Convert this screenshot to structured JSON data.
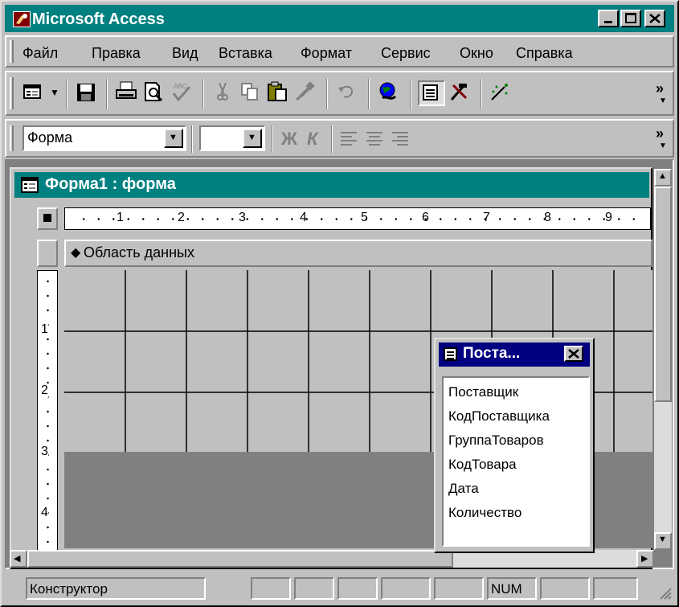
{
  "window": {
    "title": "Microsoft Access"
  },
  "menu": {
    "items": [
      {
        "label": "Файл"
      },
      {
        "label": "Правка"
      },
      {
        "label": "Вид"
      },
      {
        "label": "Вставка"
      },
      {
        "label": "Формат"
      },
      {
        "label": "Сервис"
      },
      {
        "label": "Окно"
      },
      {
        "label": "Справка"
      }
    ]
  },
  "toolbar": {
    "overflow": "»"
  },
  "format_toolbar": {
    "object_value": "Форма",
    "font_value": "",
    "bold": "Ж",
    "italic": "К",
    "overflow": "»"
  },
  "form_window": {
    "title": "Форма1 : форма",
    "ruler_marks": [
      "1",
      "2",
      "3",
      "4",
      "5",
      "6",
      "7",
      "8",
      "9"
    ],
    "vruler_marks": [
      "1",
      "2",
      "3",
      "4"
    ],
    "section_label": "Область данных"
  },
  "field_list": {
    "title": "Поста...",
    "fields": [
      "Поставщик",
      "КодПоставщика",
      "ГруппаТоваров",
      "КодТовара",
      "Дата",
      "Количество"
    ]
  },
  "statusbar": {
    "mode": "Конструктор",
    "num": "NUM"
  }
}
